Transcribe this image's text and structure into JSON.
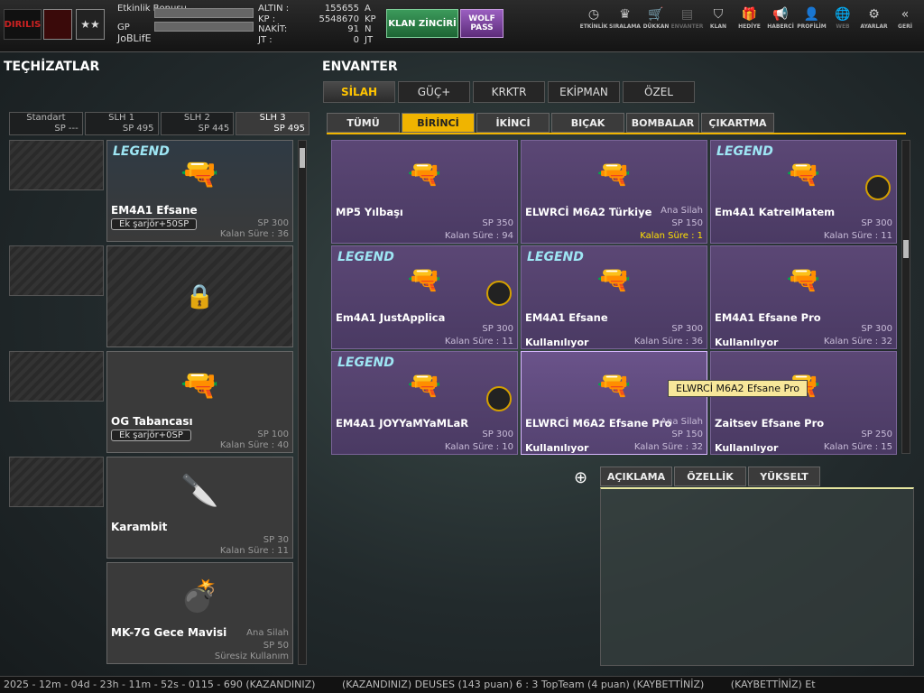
{
  "player": {
    "logo": "DIRILIS",
    "rank_icon": "★★",
    "bonus_label": "Etkinlik Bonusu",
    "gp_label": "GP",
    "name": "JoBLifE"
  },
  "currency": [
    {
      "k": "ALTIN :",
      "v": "155655",
      "u": "A"
    },
    {
      "k": "KP :",
      "v": "5548670",
      "u": "KP"
    },
    {
      "k": "NAKİT:",
      "v": "91",
      "u": "N"
    },
    {
      "k": "JT :",
      "v": "0",
      "u": "JT"
    }
  ],
  "buttons": {
    "klan": "KLAN ZİNCİRİ",
    "wolf": "WOLF PASS"
  },
  "nav": [
    {
      "label": "ETKİNLİK",
      "icon": "◷"
    },
    {
      "label": "SIRALAMA",
      "icon": "♛"
    },
    {
      "label": "DÜKKAN",
      "icon": "🛒"
    },
    {
      "label": "ENVANTER",
      "icon": "▤"
    },
    {
      "label": "KLAN",
      "icon": "⛉"
    },
    {
      "label": "HEDİYE",
      "icon": "🎁"
    },
    {
      "label": "HABERCİ",
      "icon": "📢"
    },
    {
      "label": "PROFİLİM",
      "icon": "👤"
    },
    {
      "label": "WEB",
      "icon": "🌐"
    },
    {
      "label": "AYARLAR",
      "icon": "⚙"
    },
    {
      "label": "GERİ",
      "icon": "«"
    }
  ],
  "left": {
    "title": "TEÇHİZATLAR",
    "tabs": [
      {
        "n": "Standart",
        "s": "SP ---"
      },
      {
        "n": "SLH 1",
        "s": "SP 495"
      },
      {
        "n": "SLH 2",
        "s": "SP 445"
      },
      {
        "n": "SLH 3",
        "s": "SP 495"
      }
    ],
    "cards": [
      {
        "name": "EM4A1 Efsane",
        "badge": "Ek şarjör+50SP",
        "sp": "SP 300",
        "rem": "Kalan Süre : 36",
        "icon": "🔫",
        "legend": "LEGEND"
      },
      {
        "name": "OG Tabancası",
        "badge": "Ek şarjör+0SP",
        "sp": "SP 100",
        "rem": "Kalan Süre : 40",
        "icon": "🔫"
      },
      {
        "name": "Karambit",
        "sp": "SP 30",
        "rem": "Kalan Süre : 11",
        "icon": "🔪"
      },
      {
        "name": "MK-7G Gece Mavisi",
        "cat": "Ana Silah",
        "sp": "SP 50",
        "rem": "Süresiz Kullanım",
        "icon": "💣"
      }
    ]
  },
  "right": {
    "title": "ENVANTER",
    "main_tabs": [
      "SİLAH",
      "GÜÇ+",
      "KRKTR",
      "EKİPMAN",
      "ÖZEL"
    ],
    "sub_tabs": [
      "TÜMÜ",
      "BİRİNCİ",
      "İKİNCİ",
      "BIÇAK",
      "BOMBALAR",
      "ÇIKARTMA"
    ],
    "items": [
      {
        "name": "MP5 Yılbaşı",
        "sp": "SP 350",
        "rem": "Kalan Süre : 94",
        "icon": "🔫"
      },
      {
        "name": "ELWRCİ M6A2 Türkiye",
        "cat": "Ana Silah",
        "sp": "SP 150",
        "rem": "Kalan Süre : 1",
        "icon": "🔫"
      },
      {
        "name": "Em4A1 KatreIMatem",
        "sp": "SP 300",
        "rem": "Kalan Süre : 11",
        "icon": "🔫",
        "legend": "LEGEND"
      },
      {
        "name": "Em4A1 JustApplica",
        "sp": "SP 300",
        "rem": "Kalan Süre : 11",
        "icon": "🔫",
        "legend": "LEGEND"
      },
      {
        "name": "EM4A1 Efsane",
        "sp": "SP 300",
        "rem": "Kalan Süre : 36",
        "use": "Kullanılıyor",
        "icon": "🔫",
        "legend": "LEGEND"
      },
      {
        "name": "EM4A1 Efsane Pro",
        "sp": "SP 300",
        "rem": "Kalan Süre : 32",
        "use": "Kullanılıyor",
        "icon": "🔫"
      },
      {
        "name": "EM4A1 JOYYaMYaMLaR",
        "sp": "SP 300",
        "rem": "Kalan Süre : 10",
        "icon": "🔫",
        "legend": "LEGEND"
      },
      {
        "name": "ELWRCİ M6A2 Efsane Pro",
        "cat": "Ana Silah",
        "sp": "SP 150",
        "rem": "Kalan Süre : 32",
        "use": "Kullanılıyor",
        "icon": "🔫"
      },
      {
        "name": "Zaitsev Efsane Pro",
        "sp": "SP 250",
        "rem": "Kalan Süre : 15",
        "use": "Kullanılıyor",
        "icon": "🔫"
      }
    ],
    "tooltip": "ELWRCİ M6A2 Efsane Pro",
    "desc_tabs": [
      "AÇIKLAMA",
      "ÖZELLİK",
      "YÜKSELT"
    ]
  },
  "ticker": [
    "2025 - 12m - 04d - 23h - 11m - 52s - 0115 - 690 (KAZANDINIZ)",
    "(KAZANDINIZ) DEUSES (143 puan) 6 : 3 TopTeam (4 puan) (KAYBETTİNİZ)",
    "(KAYBETTİNİZ) Et"
  ]
}
